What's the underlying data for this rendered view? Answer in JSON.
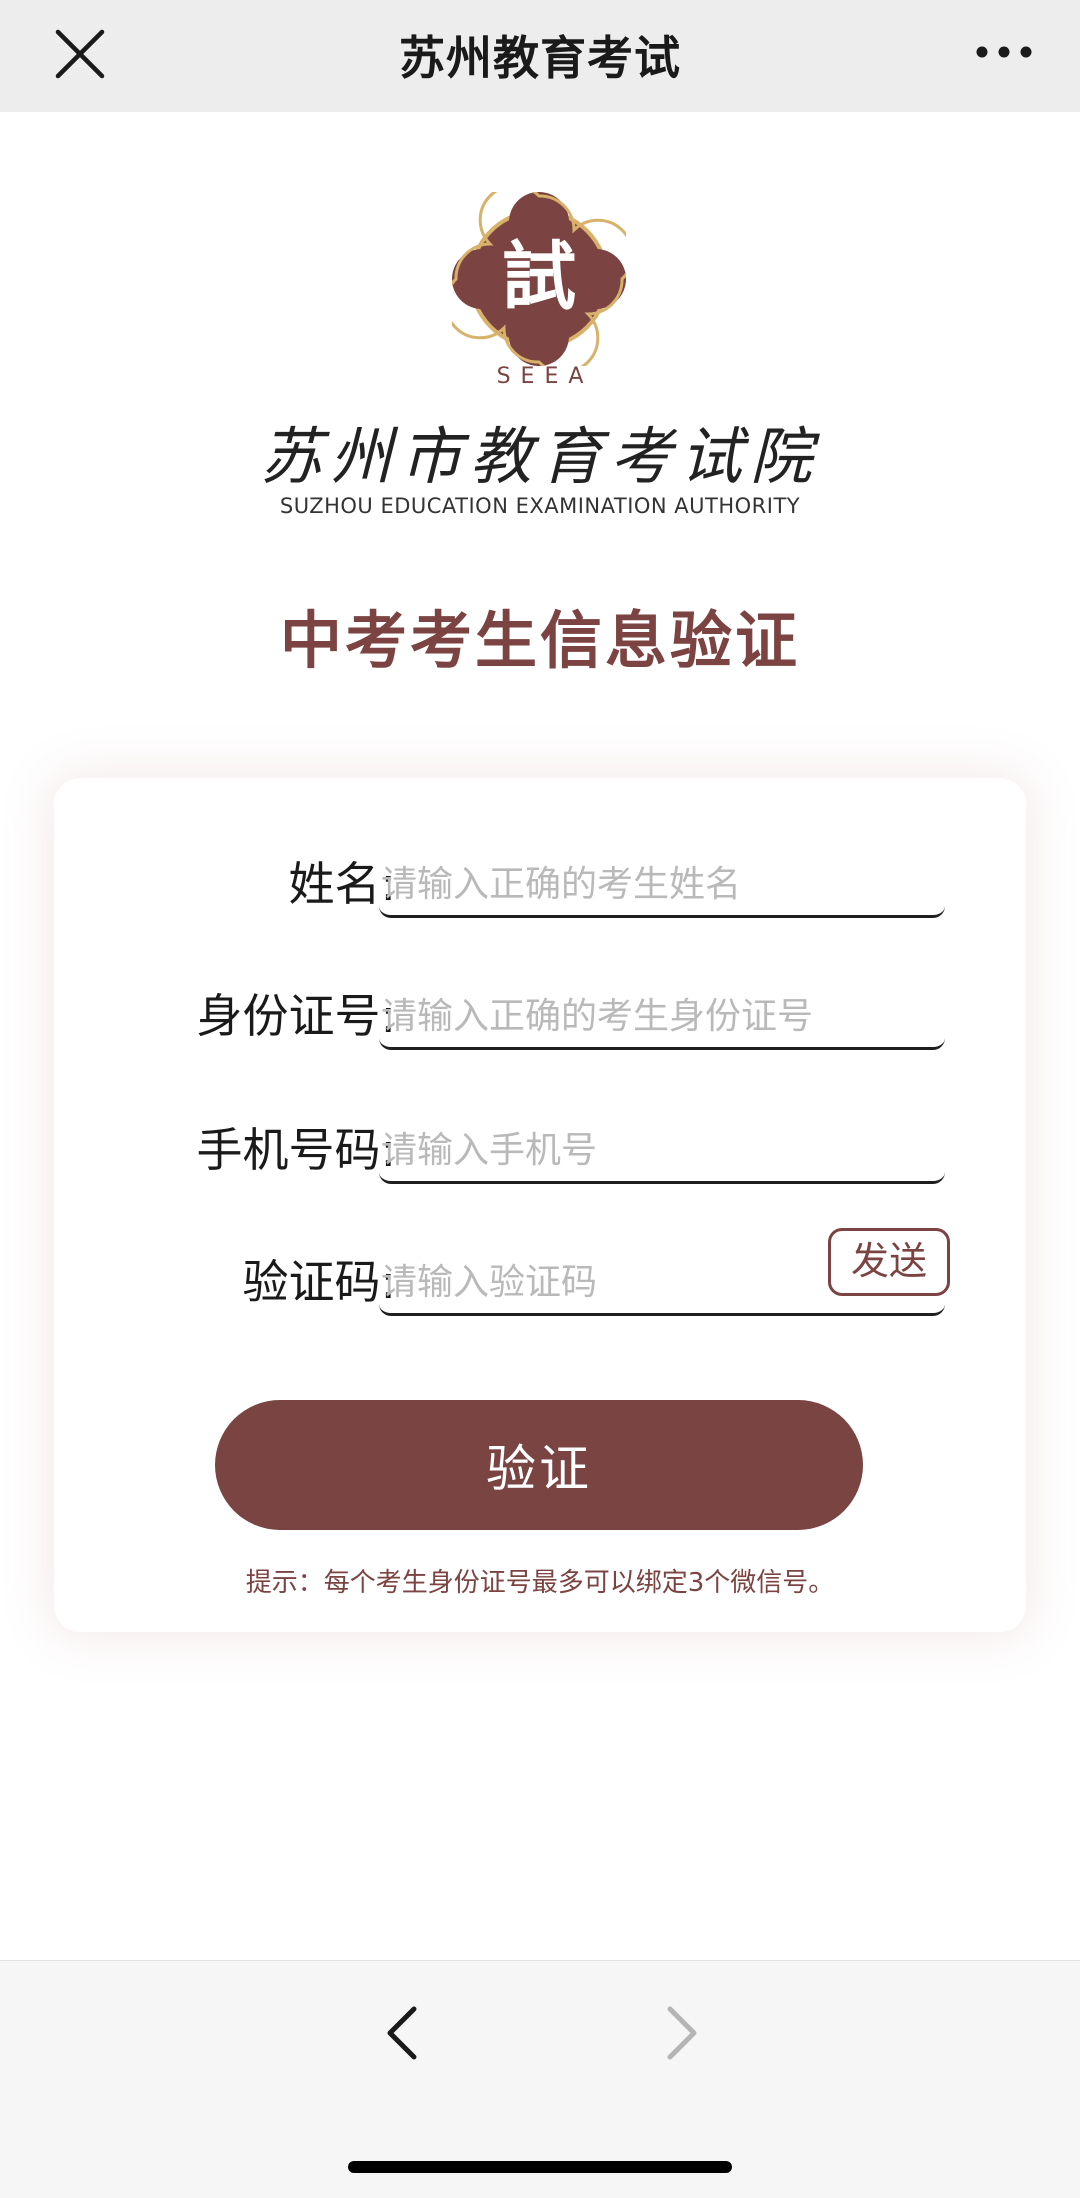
{
  "nav": {
    "title": "苏州教育考试",
    "close_icon": "close-icon",
    "more_icon": "more-dots-icon"
  },
  "logo": {
    "seal_char": "試",
    "seal_abbr": "SEEA",
    "authority_cn": "苏州市教育考试院",
    "authority_en": "SUZHOU EDUCATION EXAMINATION AUTHORITY"
  },
  "headline": "中考考生信息验证",
  "form": {
    "name": {
      "label": "姓名:",
      "placeholder": "请输入正确的考生姓名"
    },
    "id_number": {
      "label": "身份证号:",
      "placeholder": "请输入正确的考生身份证号"
    },
    "phone": {
      "label": "手机号码:",
      "placeholder": "请输入手机号"
    },
    "code": {
      "label": "验证码:",
      "placeholder": "请输入验证码",
      "send_label": "发送"
    },
    "submit_label": "验证",
    "hint": "提示：每个考生身份证号最多可以绑定3个微信号。"
  },
  "bottom_nav": {
    "back_icon": "chevron-left-icon",
    "forward_icon": "chevron-right-icon"
  },
  "colors": {
    "brand": "#7b4341",
    "seal_gold": "#d8b16a",
    "topbar_bg": "#ededed"
  }
}
